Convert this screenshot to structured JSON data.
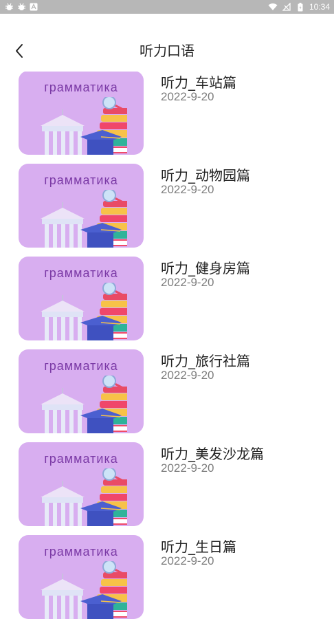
{
  "status_bar": {
    "time": "10:34",
    "left_icons": [
      "bug-icon",
      "bug-icon",
      "a-icon"
    ],
    "right_icons": [
      "wifi-icon",
      "signal-off-icon",
      "battery-icon"
    ]
  },
  "header": {
    "title": "听力口语",
    "back_icon": "chevron-left-icon"
  },
  "thumbnail": {
    "label": "грамматика",
    "background": "#d8aef0",
    "label_color": "#7b3aa6"
  },
  "items": [
    {
      "title": "听力_车站篇",
      "date": "2022-9-20"
    },
    {
      "title": "听力_动物园篇",
      "date": "2022-9-20"
    },
    {
      "title": "听力_健身房篇",
      "date": "2022-9-20"
    },
    {
      "title": "听力_旅行社篇",
      "date": "2022-9-20"
    },
    {
      "title": "听力_美发沙龙篇",
      "date": "2022-9-20"
    },
    {
      "title": "听力_生日篇",
      "date": "2022-9-20"
    }
  ]
}
